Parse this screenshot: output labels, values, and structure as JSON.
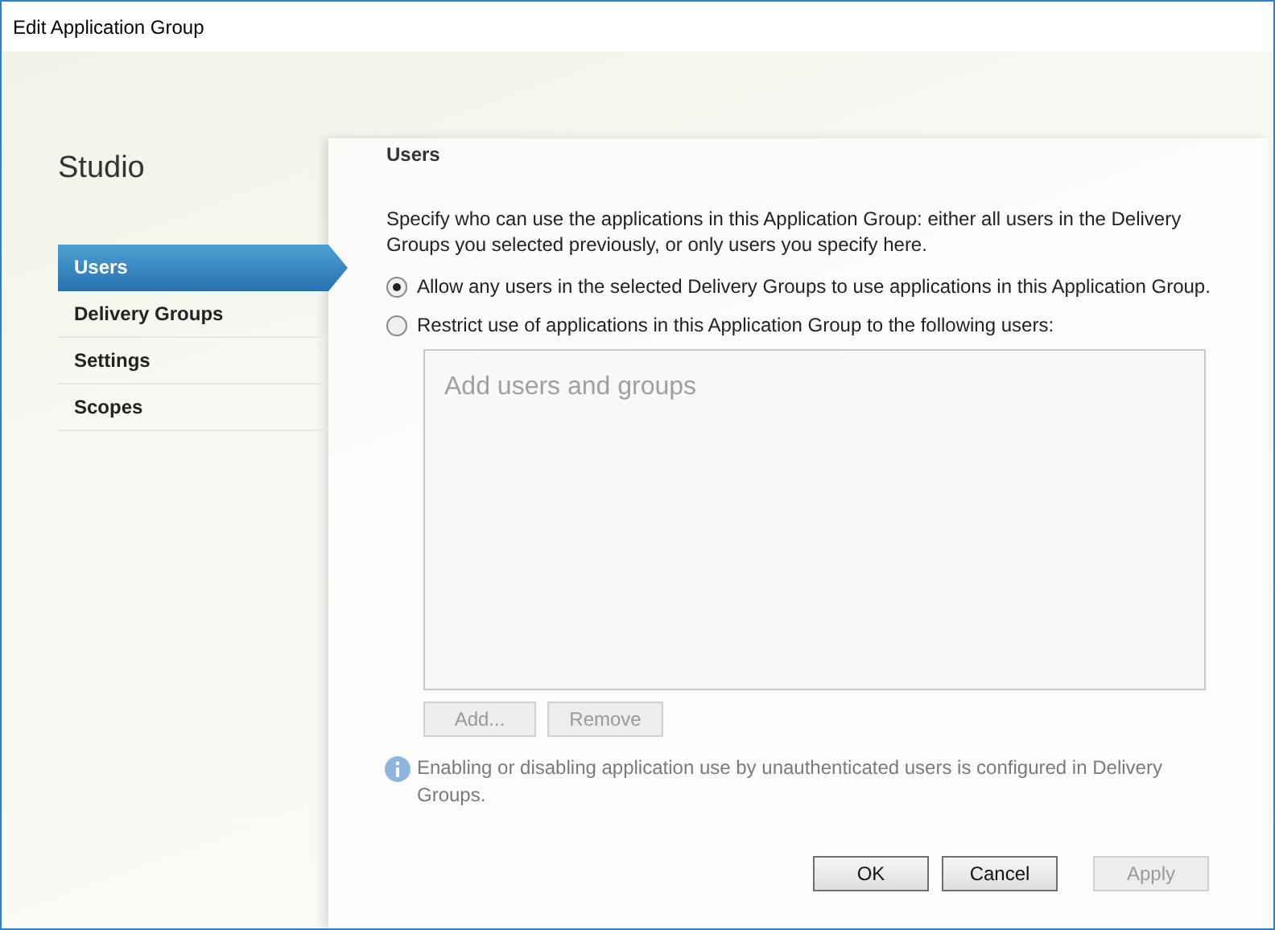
{
  "window": {
    "title": "Edit Application Group"
  },
  "sidebar": {
    "title": "Studio",
    "items": [
      {
        "label": "Users",
        "selected": true
      },
      {
        "label": "Delivery Groups",
        "selected": false
      },
      {
        "label": "Settings",
        "selected": false
      },
      {
        "label": "Scopes",
        "selected": false
      }
    ]
  },
  "page": {
    "heading": "Users",
    "description": "Specify who can use the applications in this Application Group: either all users in the Delivery Groups you selected previously, or only users you specify here.",
    "options": [
      {
        "label": "Allow any users in the selected Delivery Groups to use applications in this Application Group.",
        "selected": true
      },
      {
        "label": "Restrict use of applications in this Application Group to the following users:",
        "selected": false
      }
    ],
    "users_list": {
      "placeholder": "Add users and groups",
      "disabled": true
    },
    "list_buttons": [
      {
        "label": "Add...",
        "disabled": true
      },
      {
        "label": "Remove",
        "disabled": true
      }
    ],
    "info": "Enabling or disabling application use by unauthenticated users is configured in Delivery Groups."
  },
  "buttons": [
    {
      "label": "OK",
      "disabled": false
    },
    {
      "label": "Cancel",
      "disabled": false
    },
    {
      "label": "Apply",
      "disabled": true
    }
  ]
}
